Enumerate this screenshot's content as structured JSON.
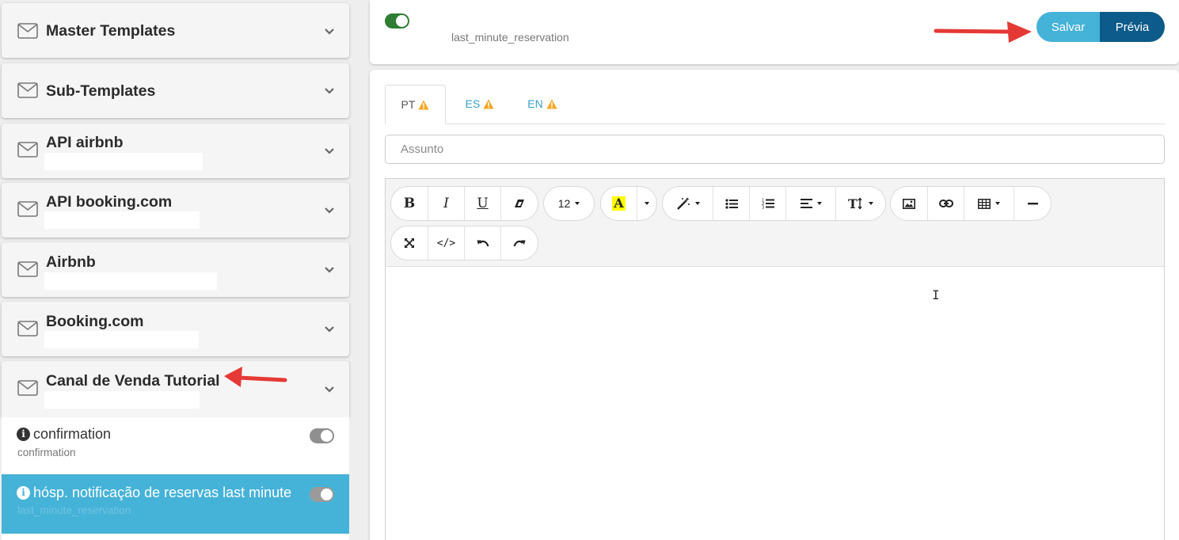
{
  "sidebar": {
    "groups": [
      {
        "title": "Master Templates"
      },
      {
        "title": "Sub-Templates"
      },
      {
        "title": "API airbnb"
      },
      {
        "title": "API booking.com"
      },
      {
        "title": "Airbnb"
      },
      {
        "title": "Booking.com"
      },
      {
        "title": "Canal de Venda Tutorial"
      }
    ],
    "templates": [
      {
        "name": "confirmation",
        "code": "confirmation",
        "enabled": false,
        "selected": false
      },
      {
        "name": "hósp. notificação de reservas last minute",
        "code": "last_minute_reservation",
        "enabled": false,
        "selected": true
      }
    ]
  },
  "topbar": {
    "enabled": true,
    "template_code": "last_minute_reservation",
    "save_label": "Salvar",
    "preview_label": "Prévia"
  },
  "tabs": [
    {
      "label": "PT",
      "warning": true,
      "active": true
    },
    {
      "label": "ES",
      "warning": true,
      "active": false
    },
    {
      "label": "EN",
      "warning": true,
      "active": false
    }
  ],
  "subject": {
    "placeholder": "Assunto",
    "value": ""
  },
  "toolbar": {
    "font_size": "12",
    "icons": [
      "bold-icon",
      "italic-icon",
      "underline-icon",
      "eraser-icon",
      "font-size-dropdown",
      "text-color-icon",
      "magic-wand-icon",
      "bullet-list-icon",
      "numbered-list-icon",
      "align-icon",
      "line-height-icon",
      "image-icon",
      "link-icon",
      "table-icon",
      "horizontal-rule-icon",
      "fullscreen-icon",
      "code-view-icon",
      "undo-icon",
      "redo-icon"
    ]
  },
  "colors": {
    "salvar": "#45b2d8",
    "previa": "#0d5b8a",
    "selected_item": "#45b2d8",
    "toggle_on": "#2e7d32",
    "warning": "#f5a623",
    "annotation_arrow": "#e53935"
  }
}
